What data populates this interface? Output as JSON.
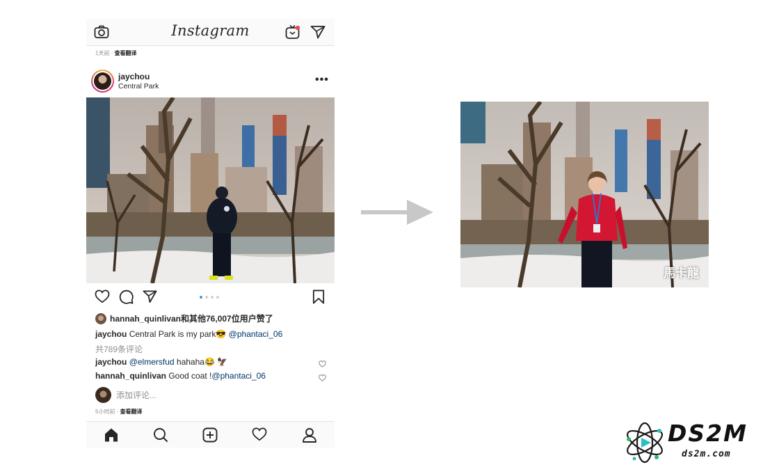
{
  "app": {
    "logo_text": "Instagram",
    "icons": {
      "camera": "camera-icon",
      "igtv": "igtv-icon",
      "direct": "paper-plane-icon"
    }
  },
  "feed": {
    "prev_post_meta": {
      "time": "1天前",
      "separator": " · ",
      "translate": "查看翻译"
    }
  },
  "post": {
    "username": "jaychou",
    "location": "Central Park",
    "more_label": "•••",
    "photo": "man-in-central-park-snow-photo",
    "carousel": {
      "count": 4,
      "active": 1
    },
    "likes_text": "hannah_quinlivan和其他76,007位用户赞了",
    "caption": {
      "user": "jaychou",
      "text": " Central Park is my park😎 ",
      "mention": "@phantaci_06"
    },
    "view_all_comments": "共789条评论",
    "comments": [
      {
        "user": "jaychou",
        "mention": " @elmersfud",
        "text": " hahaha😂 🦅"
      },
      {
        "user": "hannah_quinlivan",
        "mention": "",
        "text": " Good coat !",
        "mention2": "@phantaci_06"
      }
    ],
    "add_comment_placeholder": "添加评论...",
    "meta": {
      "time": "5小时前",
      "separator": " · ",
      "translate": "查看翻译"
    }
  },
  "bottom_nav": [
    "home-icon",
    "search-icon",
    "add-post-icon",
    "activity-heart-icon",
    "profile-icon"
  ],
  "right_panel": {
    "photo": "woman-in-red-sweater-central-park-photo",
    "watermark": "馬卡龍"
  },
  "site_logo": {
    "brand": "DS2M",
    "url": "ds2m.com"
  },
  "colors": {
    "accent_blue": "#3897f0",
    "mention_blue": "#003569",
    "muted": "#8e8e8e",
    "text": "#262626"
  }
}
